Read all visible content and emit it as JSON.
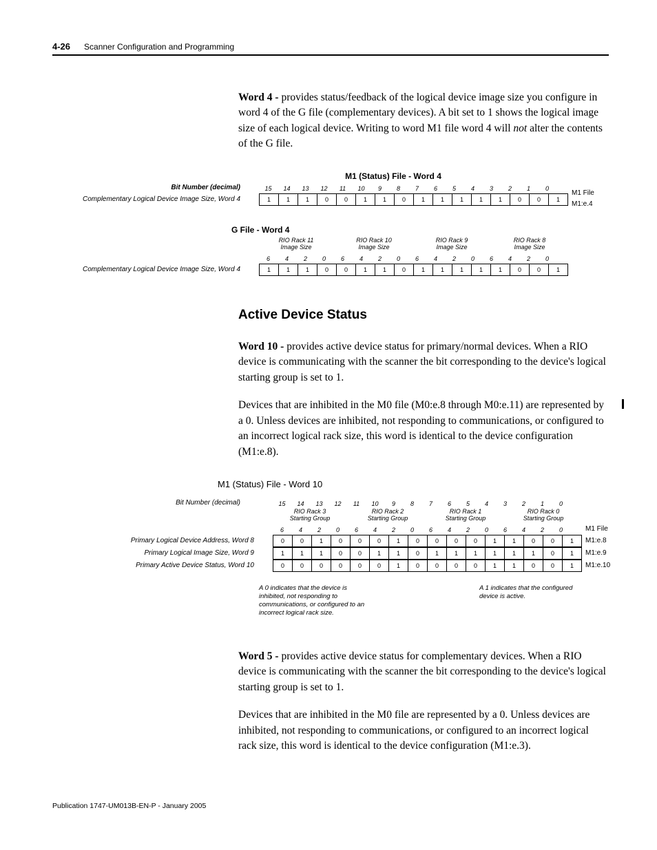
{
  "header": {
    "page_num": "4-26",
    "title": "Scanner Configuration and Programming"
  },
  "para_word4": {
    "lead": "Word 4 -",
    "text_a": " provides status/feedback of the logical device image size you configure in word 4 of the G file (complementary devices). A bit set to 1 shows the logical image size of each logical device. Writing to word M1 file word 4 will ",
    "not": "not",
    "text_b": " alter the contents of the G file."
  },
  "diagram1": {
    "title_m1": "M1 (Status) File - Word 4",
    "bit_label": "Bit Number (decimal)",
    "bits": [
      "15",
      "14",
      "13",
      "12",
      "11",
      "10",
      "9",
      "8",
      "7",
      "6",
      "5",
      "4",
      "3",
      "2",
      "1",
      "0"
    ],
    "row1_label": "Complementary Logical Device Image Size, Word 4",
    "row1": [
      "1",
      "1",
      "1",
      "0",
      "0",
      "1",
      "1",
      "0",
      "1",
      "1",
      "1",
      "1",
      "1",
      "0",
      "0",
      "1"
    ],
    "right_top": "M1 File",
    "right_m1e4": "M1:e.4",
    "title_g": "G File - Word 4",
    "groups": [
      {
        "name_line1": "RIO Rack 11",
        "name_line2": "Image Size"
      },
      {
        "name_line1": "RIO Rack 10",
        "name_line2": "Image Size"
      },
      {
        "name_line1": "RIO Rack 9",
        "name_line2": "Image Size"
      },
      {
        "name_line1": "RIO Rack 8",
        "name_line2": "Image Size"
      }
    ],
    "group_nums": [
      "6",
      "4",
      "2",
      "0",
      "6",
      "4",
      "2",
      "0",
      "6",
      "4",
      "2",
      "0",
      "6",
      "4",
      "2",
      "0"
    ],
    "row2_label": "Complementary Logical Device Image Size, Word 4",
    "row2": [
      "1",
      "1",
      "1",
      "0",
      "0",
      "1",
      "1",
      "0",
      "1",
      "1",
      "1",
      "1",
      "1",
      "0",
      "0",
      "1"
    ]
  },
  "section_heading": "Active Device Status",
  "para_word10": {
    "lead": "Word 10 -",
    "text": " provides active device status for primary/normal devices. When a RIO device is communicating with the scanner the bit corresponding to the device's logical starting group is set to 1."
  },
  "para_inhibit10": "Devices that are inhibited in the M0 file (M0:e.8 through M0:e.11) are represented by a 0. Unless devices are inhibited, not responding to communications, or configured to an incorrect logical rack size, this word is identical to the device configuration (M1:e.8).",
  "diagram2": {
    "title": "M1 (Status) File - Word 10",
    "bit_label": "Bit Number (decimal)",
    "bits": [
      "15",
      "14",
      "13",
      "12",
      "11",
      "10",
      "9",
      "8",
      "7",
      "6",
      "5",
      "4",
      "3",
      "2",
      "1",
      "0"
    ],
    "groups": [
      {
        "name_line1": "RIO Rack 3",
        "name_line2": "Starting Group"
      },
      {
        "name_line1": "RIO Rack 2",
        "name_line2": "Starting Group"
      },
      {
        "name_line1": "RIO Rack 1",
        "name_line2": "Starting Group"
      },
      {
        "name_line1": "RIO Rack 0",
        "name_line2": "Starting Group"
      }
    ],
    "group_nums": [
      "6",
      "4",
      "2",
      "0",
      "6",
      "4",
      "2",
      "0",
      "6",
      "4",
      "2",
      "0",
      "6",
      "4",
      "2",
      "0"
    ],
    "right_top": "M1 File",
    "rows": [
      {
        "label": "Primary Logical Device Address, Word 8",
        "right": "M1:e.8",
        "vals": [
          "0",
          "0",
          "1",
          "0",
          "0",
          "0",
          "1",
          "0",
          "0",
          "0",
          "0",
          "1",
          "1",
          "0",
          "0",
          "1"
        ]
      },
      {
        "label": "Primary Logical Image Size, Word 9",
        "right": "M1:e.9",
        "vals": [
          "1",
          "1",
          "1",
          "0",
          "0",
          "1",
          "1",
          "0",
          "1",
          "1",
          "1",
          "1",
          "1",
          "1",
          "0",
          "1"
        ]
      },
      {
        "label": "Primary Active Device Status, Word 10",
        "right": "M1:e.10",
        "vals": [
          "0",
          "0",
          "0",
          "0",
          "0",
          "0",
          "1",
          "0",
          "0",
          "0",
          "0",
          "1",
          "1",
          "0",
          "0",
          "1"
        ]
      }
    ],
    "note_left": "A 0 indicates that the device is inhibited, not responding to communications, or configured to an incorrect logical rack size.",
    "note_right": "A 1 indicates that the configured device is active."
  },
  "para_word5": {
    "lead": "Word 5 -",
    "text": " provides active device status for complementary devices. When a RIO device is communicating with the scanner the bit corresponding to the device's logical starting group is set to 1."
  },
  "para_inhibit5": "Devices that are inhibited in the M0 file are represented by a 0. Unless devices are inhibited, not responding to communications, or configured to an incorrect logical rack size, this word is identical to the device configuration (M1:e.3).",
  "footer": "Publication 1747-UM013B-EN-P - January 2005"
}
